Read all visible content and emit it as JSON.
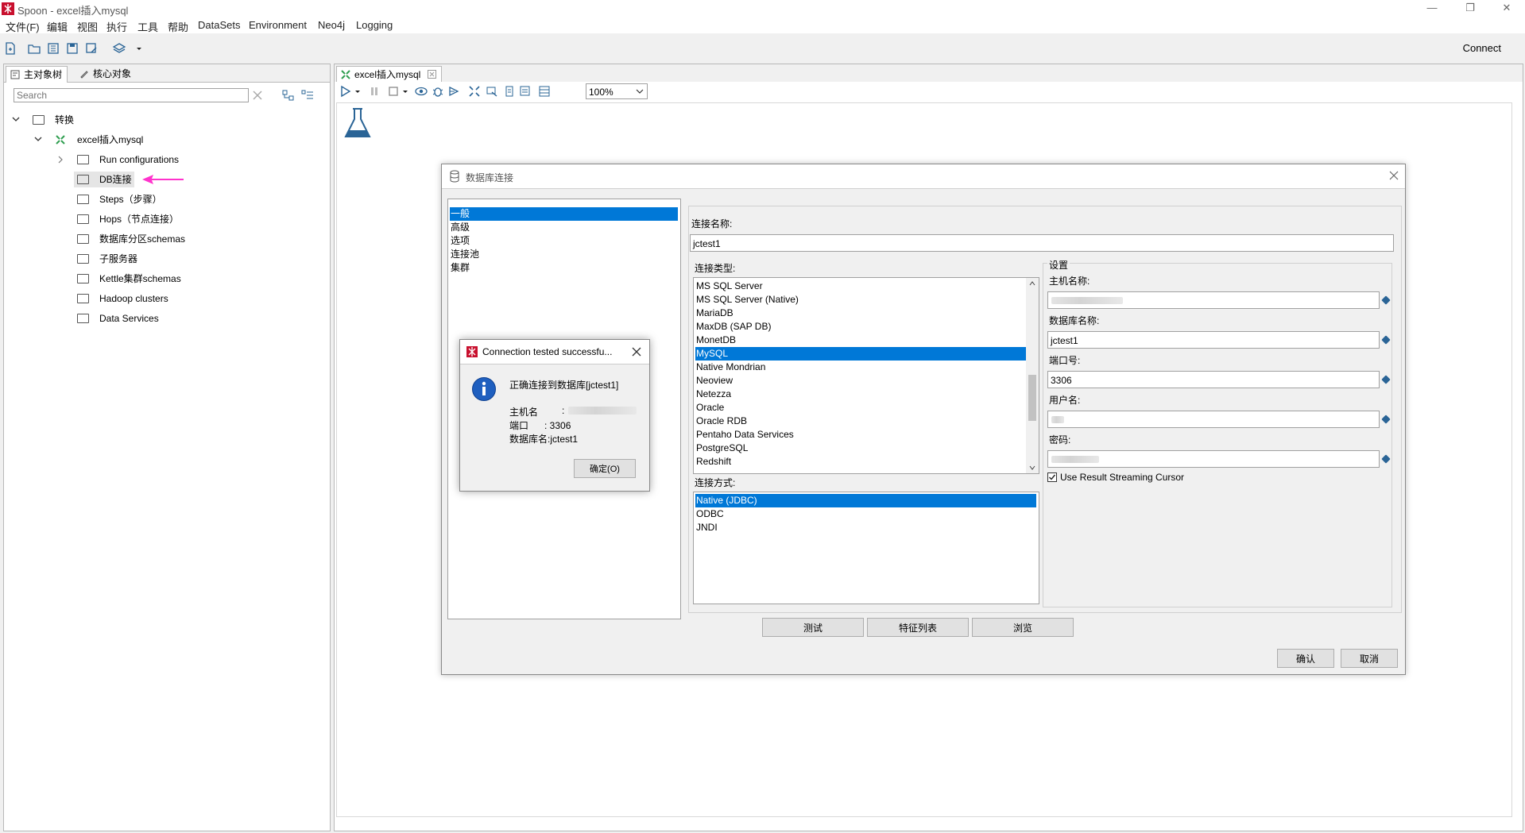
{
  "window": {
    "title": "Spoon - excel插入mysql",
    "connect_label": "Connect",
    "minimize": "—",
    "restore": "❐",
    "close": "✕"
  },
  "menu": [
    "文件(F)",
    "编辑",
    "视图",
    "执行",
    "工具",
    "帮助",
    "DataSets",
    "Environment",
    "Neo4j",
    "Logging"
  ],
  "left_panel": {
    "tabs": [
      "主对象树",
      "核心对象"
    ],
    "search_placeholder": "Search",
    "tree": {
      "root": "转换",
      "transform": "excel插入mysql",
      "children": [
        "Run configurations",
        "DB连接",
        "Steps（步骤）",
        "Hops（节点连接）",
        "数据库分区schemas",
        "子服务器",
        "Kettle集群schemas",
        "Hadoop clusters",
        "Data Services"
      ]
    }
  },
  "editor": {
    "tab_label": "excel插入mysql",
    "zoom": "100%"
  },
  "db_dialog": {
    "title": "数据库连接",
    "nav": [
      "一般",
      "高级",
      "选项",
      "连接池",
      "集群"
    ],
    "conn_name_label": "连接名称:",
    "conn_name_value": "jctest1",
    "conn_type_label": "连接类型:",
    "conn_types": [
      "MS SQL Server",
      "MS SQL Server (Native)",
      "MariaDB",
      "MaxDB (SAP DB)",
      "MonetDB",
      "MySQL",
      "Native Mondrian",
      "Neoview",
      "Netezza",
      "Oracle",
      "Oracle RDB",
      "Pentaho Data Services",
      "PostgreSQL",
      "Redshift"
    ],
    "conn_type_selected": "MySQL",
    "access_label": "连接方式:",
    "access_types": [
      "Native (JDBC)",
      "ODBC",
      "JNDI"
    ],
    "access_selected": "Native (JDBC)",
    "settings": {
      "group_label": "设置",
      "host_label": "主机名称:",
      "db_label": "数据库名称:",
      "db_value": "jctest1",
      "port_label": "端口号:",
      "port_value": "3306",
      "user_label": "用户名:",
      "password_label": "密码:",
      "streaming_label": "Use Result Streaming Cursor",
      "streaming_checked": true
    },
    "buttons": [
      "测试",
      "特征列表",
      "浏览"
    ],
    "ok": "确认",
    "cancel": "取消"
  },
  "success_dialog": {
    "title": "Connection tested successfu...",
    "message": "正确连接到数据库[jctest1]",
    "host_label": "主机名",
    "host_sep": ":",
    "port_line": "端口      : 3306",
    "db_line": "数据库名:jctest1",
    "ok_button": "确定(O)"
  },
  "colors": {
    "selection": "#0078d7",
    "pointer_arrow": "#ff33cc",
    "kettle_red": "#c8102e",
    "transform_green": "#2e9e4f"
  }
}
